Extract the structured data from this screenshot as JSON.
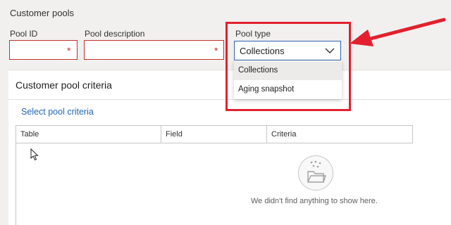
{
  "page": {
    "section_title": "Customer pools"
  },
  "form": {
    "pool_id": {
      "label": "Pool ID",
      "value": "",
      "required_mark": "*"
    },
    "pool_description": {
      "label": "Pool description",
      "value": "",
      "required_mark": "*"
    },
    "pool_type": {
      "label": "Pool type",
      "selected": "Collections",
      "options": [
        "Collections",
        "Aging snapshot"
      ]
    }
  },
  "criteria": {
    "title": "Customer pool criteria",
    "select_link": "Select pool criteria",
    "columns": [
      "Table",
      "Field",
      "Criteria"
    ],
    "empty_message": "We didn't find anything to show here."
  },
  "colors": {
    "accent": "#2b63b1",
    "required": "#c4312b",
    "annotation": "#e3202d",
    "link": "#2266b3"
  },
  "icons": [
    "chevron-down-icon",
    "empty-folder-icon",
    "mouse-cursor-icon",
    "annotation-arrow"
  ]
}
